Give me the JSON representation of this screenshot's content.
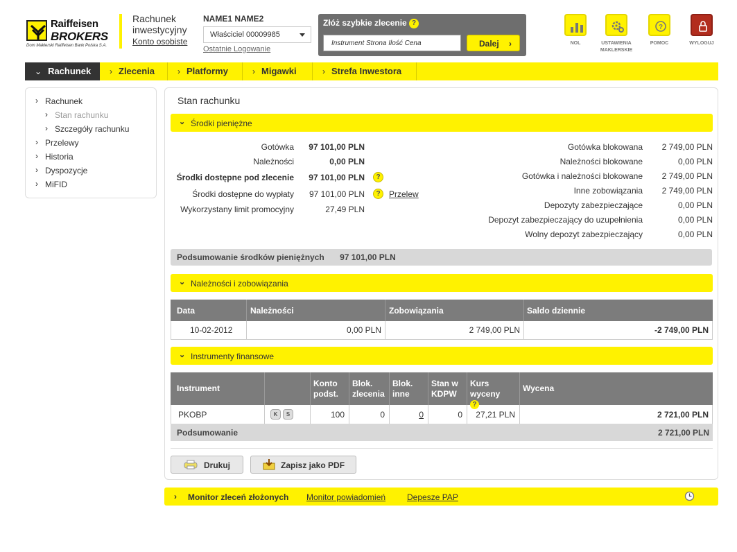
{
  "logo": {
    "line1": "Raiffeisen",
    "line2": "BROKERS",
    "tagline": "Dom Maklerski Raiffeisen Bank Polska S.A."
  },
  "account_header": {
    "title": "Rachunek inwestycyjny",
    "link": "Konto osobiste"
  },
  "user": {
    "name": "NAME1 NAME2",
    "owner_select": "Właściciel 00009985",
    "last_login": "Ostatnie Logowanie"
  },
  "quick_order": {
    "title": "Złóż szybkie zlecenie",
    "help": "?",
    "input_placeholder": "Instrument Strona Ilość Cena",
    "button": "Dalej"
  },
  "tools": [
    {
      "label": "NOL",
      "icon": "chart-icon"
    },
    {
      "label": "USTAWIENIA MAKLERSKIE",
      "icon": "gears-icon"
    },
    {
      "label": "POMOC",
      "icon": "help-icon"
    },
    {
      "label": "WYLOGUJ",
      "icon": "lock-icon"
    }
  ],
  "nav": [
    "Rachunek",
    "Zlecenia",
    "Platformy",
    "Migawki",
    "Strefa Inwestora"
  ],
  "left_menu": {
    "rachunek": "Rachunek",
    "stan": "Stan rachunku",
    "szczegoly": "Szczegóły rachunku",
    "przelewy": "Przelewy",
    "historia": "Historia",
    "dyspozycje": "Dyspozycje",
    "mifid": "MiFID"
  },
  "page_title": "Stan rachunku",
  "cash": {
    "section_title": "Środki pieniężne",
    "left": [
      {
        "label": "Gotówka",
        "value": "97 101,00 PLN"
      },
      {
        "label": "Należności",
        "value": "0,00 PLN"
      },
      {
        "label": "Środki dostępne pod zlecenie",
        "value": "97 101,00 PLN"
      },
      {
        "label": "Środki dostępne do wypłaty",
        "value": "97 101,00 PLN"
      },
      {
        "label": "Wykorzystany limit promocyjny",
        "value": "27,49 PLN"
      }
    ],
    "transfer_link": "Przelew",
    "help": "?",
    "right": [
      {
        "label": "Gotówka blokowana",
        "value": "2 749,00 PLN"
      },
      {
        "label": "Należności blokowane",
        "value": "0,00 PLN"
      },
      {
        "label": "Gotówka i należności blokowane",
        "value": "2 749,00 PLN"
      },
      {
        "label": "Inne zobowiązania",
        "value": "2 749,00 PLN"
      },
      {
        "label": "Depozyty zabezpieczające",
        "value": "0,00 PLN"
      },
      {
        "label": "Depozyt zabezpieczający do uzupełnienia",
        "value": "0,00 PLN"
      },
      {
        "label": "Wolny depozyt zabezpieczający",
        "value": "0,00 PLN"
      }
    ],
    "summary_label": "Podsumowanie środków pieniężnych",
    "summary_value": "97 101,00 PLN"
  },
  "receivables": {
    "section_title": "Należności i zobowiązania",
    "headers": [
      "Data",
      "Należności",
      "Zobowiązania",
      "Saldo dziennie"
    ],
    "row": {
      "date": "10-02-2012",
      "receivables": "0,00 PLN",
      "liabilities": "2 749,00 PLN",
      "balance": "-2 749,00 PLN"
    }
  },
  "instruments": {
    "section_title": "Instrumenty finansowe",
    "headers": {
      "instrument": "Instrument",
      "konto": "Konto podst.",
      "blok_zlecenia": "Blok. zlecenia",
      "blok_inne": "Blok. inne",
      "stan_kdpw": "Stan w KDPW",
      "kurs": "Kurs wyceny",
      "wycena": "Wycena"
    },
    "row": {
      "name": "PKOBP",
      "buy": "K",
      "sell": "S",
      "konto": "100",
      "blok_zlecenia": "0",
      "blok_inne": "0",
      "stan_kdpw": "0",
      "kurs": "27,21 PLN",
      "wycena": "2 721,00 PLN"
    },
    "summary_label": "Podsumowanie",
    "summary_value": "2 721,00 PLN"
  },
  "actions": {
    "print": "Drukuj",
    "pdf": "Zapisz jako PDF"
  },
  "footer": {
    "monitor": "Monitor zleceń złożonych",
    "notifications": "Monitor powiadomień",
    "pap": "Depesze PAP"
  }
}
